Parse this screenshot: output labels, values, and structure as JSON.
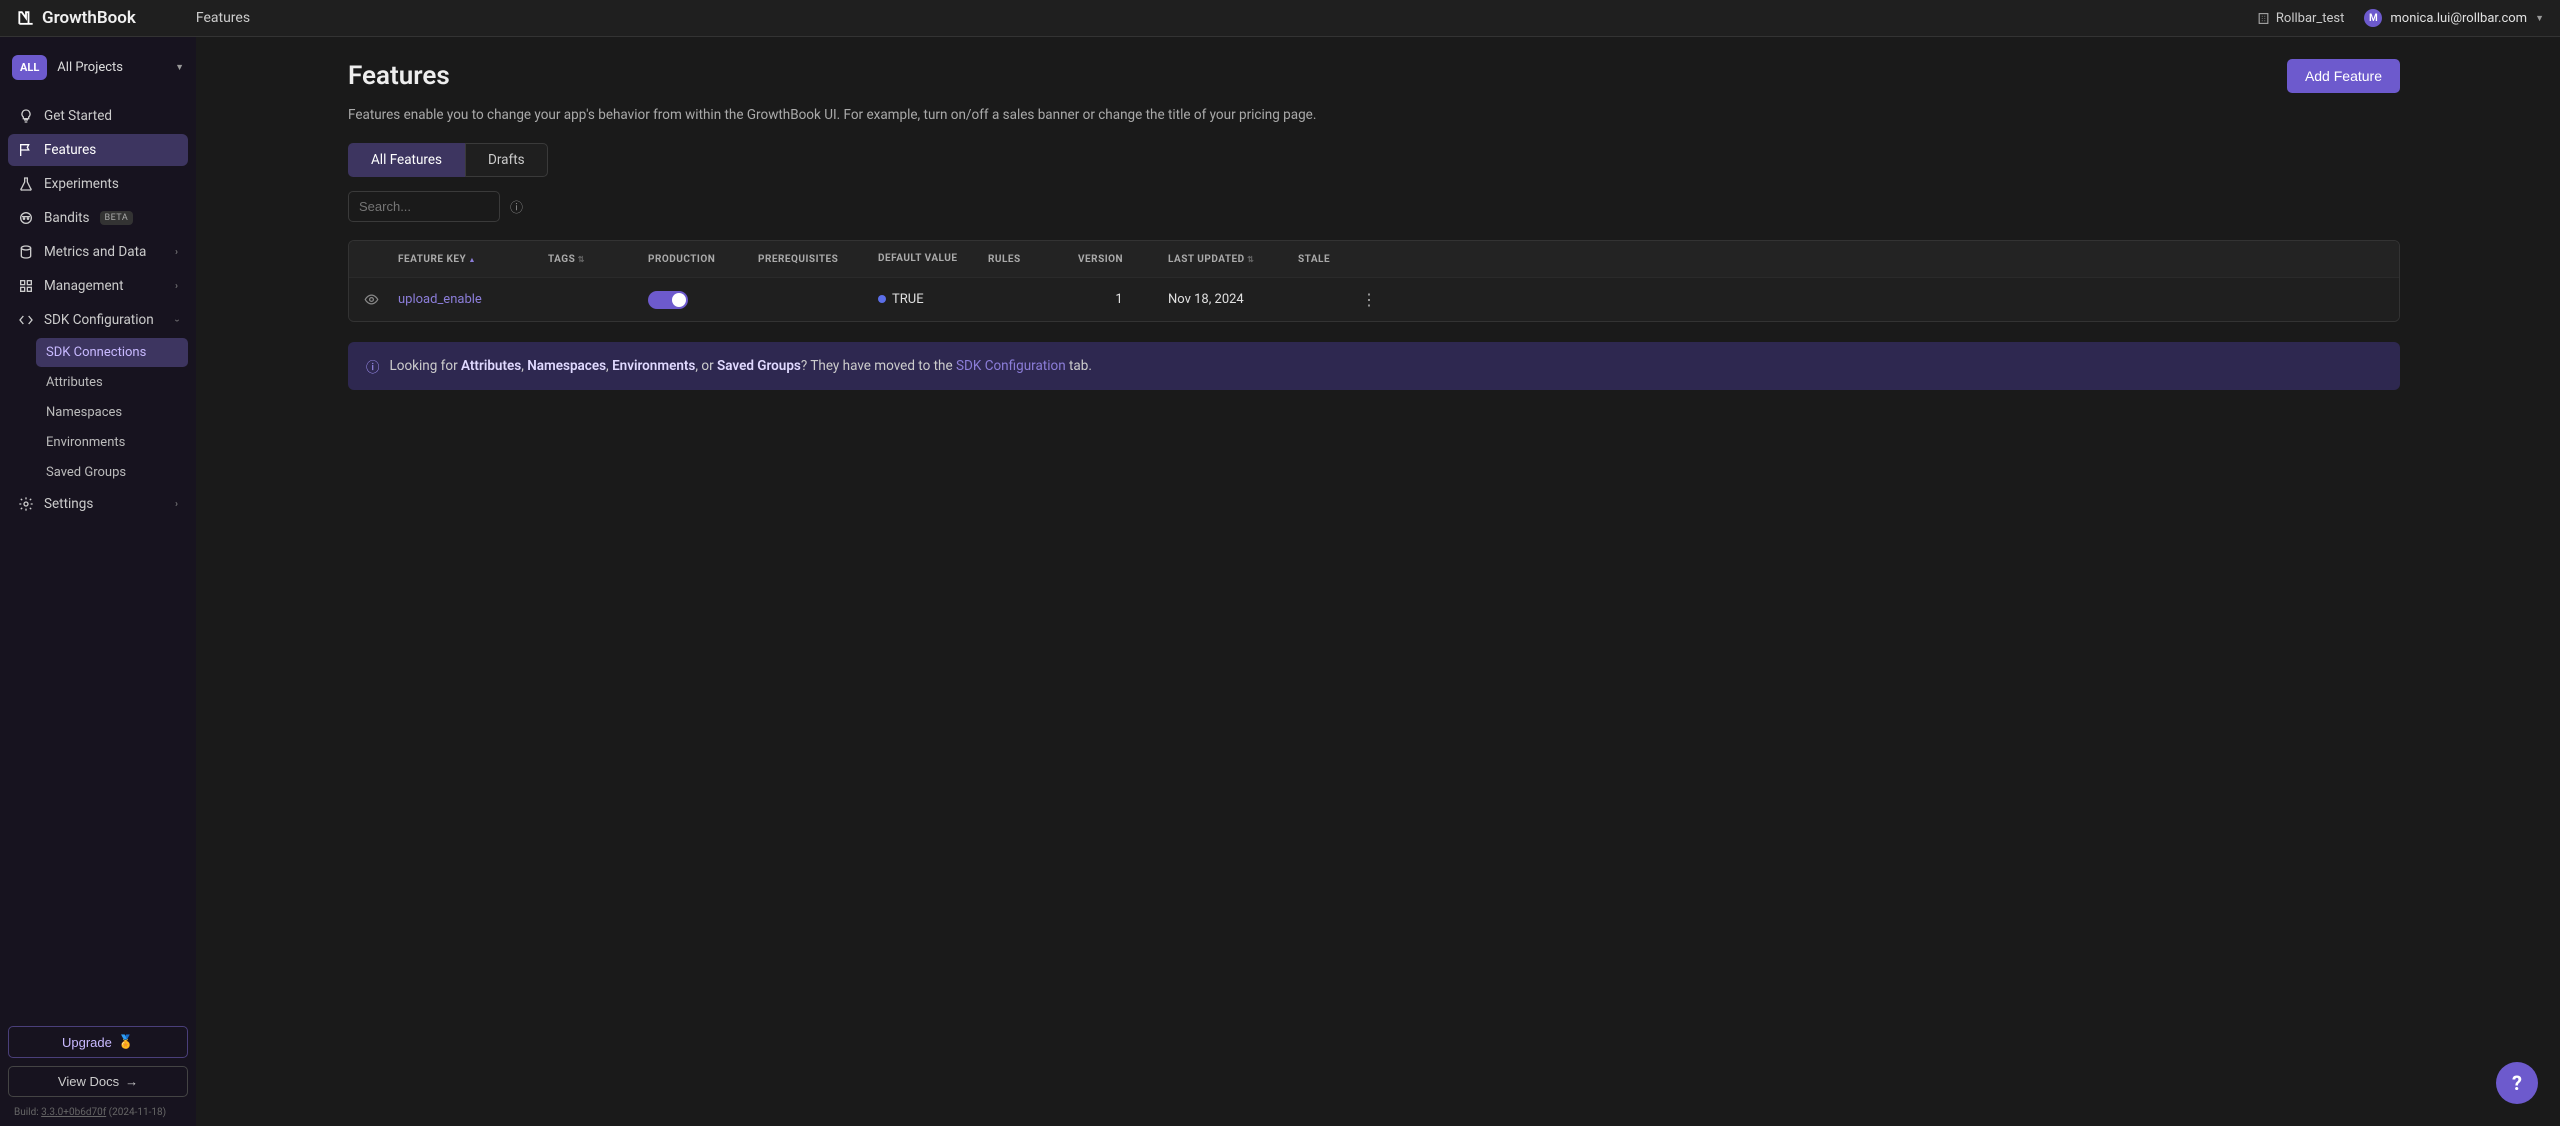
{
  "topbar": {
    "brand": "GrowthBook",
    "breadcrumb": "Features",
    "org": "Rollbar_test",
    "user_initial": "M",
    "user_email": "monica.lui@rollbar.com"
  },
  "sidebar": {
    "project_badge": "ALL",
    "project_label": "All Projects",
    "items": {
      "getStarted": "Get Started",
      "features": "Features",
      "experiments": "Experiments",
      "bandits": "Bandits",
      "banditsBadge": "BETA",
      "metrics": "Metrics and Data",
      "management": "Management",
      "sdk": "SDK Configuration",
      "settings": "Settings"
    },
    "sdkSub": {
      "connections": "SDK Connections",
      "attributes": "Attributes",
      "namespaces": "Namespaces",
      "environments": "Environments",
      "savedGroups": "Saved Groups"
    },
    "upgrade": "Upgrade",
    "docs": "View Docs",
    "build_prefix": "Build: ",
    "build_hash": "3.3.0+0b6d70f",
    "build_date": " (2024-11-18)"
  },
  "page": {
    "title": "Features",
    "add_button": "Add Feature",
    "description": "Features enable you to change your app's behavior from within the GrowthBook UI. For example, turn on/off a sales banner or change the title of your pricing page.",
    "tabs": {
      "all": "All Features",
      "drafts": "Drafts"
    },
    "search_placeholder": "Search..."
  },
  "table": {
    "headers": {
      "featureKey": "FEATURE KEY",
      "tags": "TAGS",
      "production": "PRODUCTION",
      "prerequisites": "PREREQUISITES",
      "defaultValue": "DEFAULT VALUE",
      "rules": "RULES",
      "version": "VERSION",
      "lastUpdated": "LAST UPDATED",
      "stale": "STALE"
    },
    "rows": [
      {
        "key": "upload_enable",
        "production_on": true,
        "default_value": "TRUE",
        "version": "1",
        "last_updated": "Nov 18, 2024"
      }
    ]
  },
  "notice": {
    "prefix": "Looking for ",
    "b1": "Attributes",
    "b2": "Namespaces",
    "b3": "Environments",
    "b4": "Saved Groups",
    "mid": "? They have moved to the ",
    "link": "SDK Configuration",
    "suffix": " tab."
  }
}
